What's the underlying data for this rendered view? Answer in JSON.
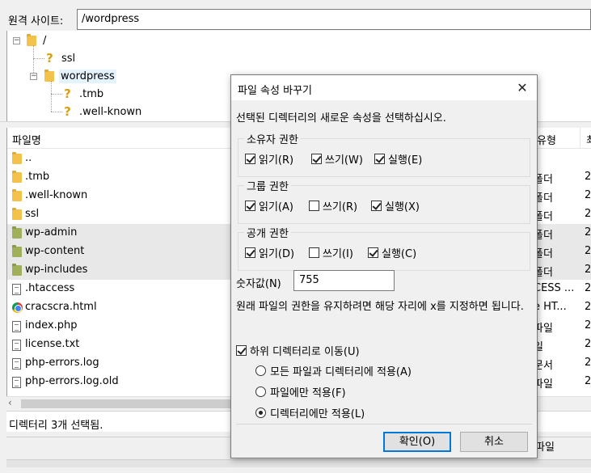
{
  "remote_site": {
    "label": "원격 사이트:",
    "path": "/wordpress"
  },
  "tree": {
    "root": "/",
    "items": [
      "ssl",
      "wordpress",
      ".tmb",
      ".well-known"
    ]
  },
  "filelist": {
    "columns": {
      "name": "파일명",
      "type": "유형",
      "date": "최"
    },
    "rows": [
      {
        "name": "..",
        "type": "",
        "date": ""
      },
      {
        "name": ".tmb",
        "type": "폴더",
        "date": "2"
      },
      {
        "name": ".well-known",
        "type": "폴더",
        "date": "2"
      },
      {
        "name": "ssl",
        "type": "폴더",
        "date": "2"
      },
      {
        "name": "wp-admin",
        "type": "폴더",
        "date": "2"
      },
      {
        "name": "wp-content",
        "type": "폴더",
        "date": "2"
      },
      {
        "name": "wp-includes",
        "type": "폴더",
        "date": "2"
      },
      {
        "name": ".htaccess",
        "type": "CESS ...",
        "date": "2"
      },
      {
        "name": "cracscra.html",
        "type": "e HT...",
        "date": "2"
      },
      {
        "name": "index.php",
        "type": "파일",
        "date": "2"
      },
      {
        "name": "license.txt",
        "type": "일",
        "date": "2"
      },
      {
        "name": "php-errors.log",
        "type": "문서",
        "date": "2"
      },
      {
        "name": "php-errors.log.old",
        "type": "파일",
        "date": "2"
      }
    ]
  },
  "status": {
    "text": "디렉터리 3개 선택됨.",
    "bottom_right": "파일"
  },
  "dialog": {
    "title": "파일 속성 바꾸기",
    "close": "✕",
    "intro": "선택된 디렉터리의 새로운 속성을 선택하십시오.",
    "owner": {
      "label": "소유자 권한",
      "read": "읽기(R)",
      "write": "쓰기(W)",
      "exec": "실행(E)"
    },
    "group": {
      "label": "그룹 권한",
      "read": "읽기(A)",
      "write": "쓰기(R)",
      "exec": "실행(X)"
    },
    "public": {
      "label": "공개 권한",
      "read": "읽기(D)",
      "write": "쓰기(I)",
      "exec": "실행(C)"
    },
    "numeric_label": "숫자값(N)",
    "numeric_value": "755",
    "hint": "원래 파일의 권한을 유지하려면 해당 자리에 x를 지정하면 됩니다.",
    "recurse": "하위 디렉터리로 이동(U)",
    "apply_all": "모든 파일과 디렉터리에 적용(A)",
    "apply_files": "파일에만 적용(F)",
    "apply_dirs": "디렉터리에만 적용(L)",
    "ok": "확인(O)",
    "cancel": "취소"
  }
}
